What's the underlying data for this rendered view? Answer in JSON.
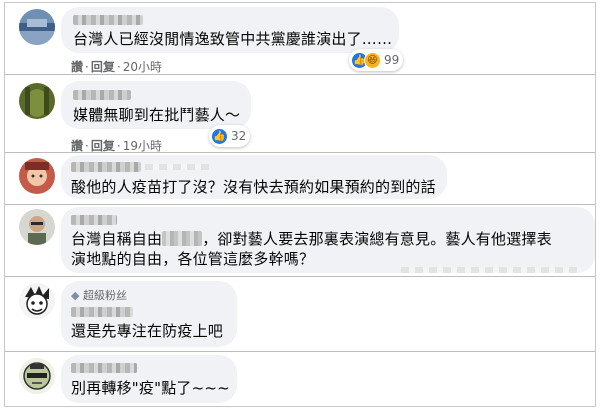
{
  "comments": [
    {
      "text": "台灣人已經沒閒情逸致管中共黨慶誰演出了……",
      "like_label": "讚",
      "reply_label": "回复",
      "time": "20小時",
      "reaction_count": "99"
    },
    {
      "text": "媒體無聊到在批鬥藝人～",
      "like_label": "讚",
      "reply_label": "回复",
      "time": "19小時",
      "reaction_count": "32"
    },
    {
      "text": "酸他的人疫苗打了沒？沒有快去預約如果預約的到的話"
    },
    {
      "text_line1_a": "台灣自稱自由",
      "text_line1_b": "，卻對藝人要去那裏表演總有意見。藝人有他選擇表",
      "text_line2": "演地點的自由，各位管這麼多幹嗎？"
    },
    {
      "badge": "超級粉丝",
      "text": "還是先專注在防疫上吧"
    },
    {
      "text": "別再轉移\"疫\"點了~~~"
    }
  ],
  "colors": {
    "bubble": "#f0f2f5",
    "meta": "#65676b",
    "like_blue": "#1877f2",
    "haha_yellow": "#f7b125"
  },
  "icons": [
    "thumbs-up-icon",
    "haha-icon",
    "diamond-icon"
  ]
}
